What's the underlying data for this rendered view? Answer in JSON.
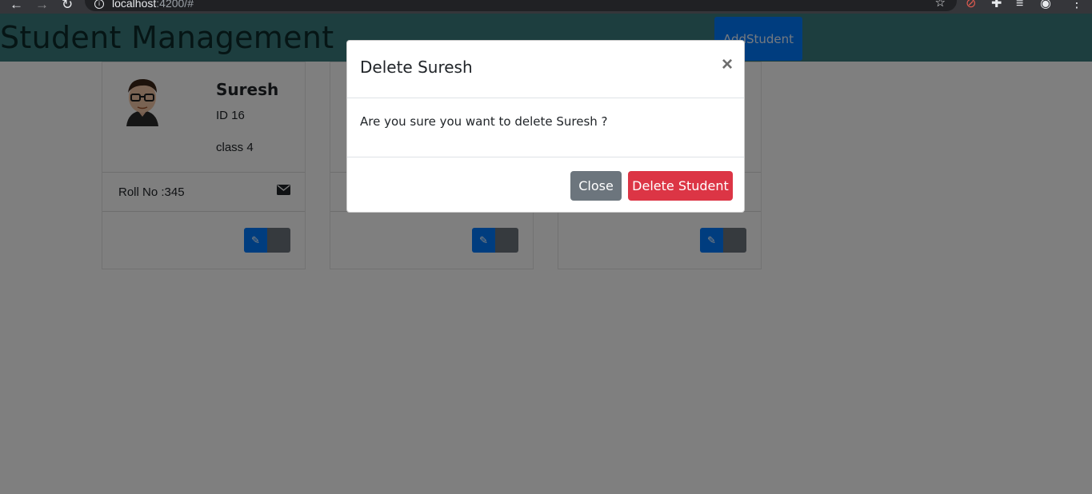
{
  "browser": {
    "url_host": "localhost",
    "url_rest": ":4200/#",
    "back_icon": "back-arrow-icon",
    "forward_icon": "forward-arrow-icon",
    "reload_icon": "reload-icon",
    "star_icon": "star-icon"
  },
  "header": {
    "title": "Student Management",
    "add_button_label": "AddStudent"
  },
  "cards": [
    {
      "name": "Suresh",
      "id_text": "ID 16",
      "class_text": "class 4",
      "roll_text": "Roll No :345"
    }
  ],
  "modal": {
    "title": "Delete Suresh",
    "close_x": "×",
    "message": "Are you sure you want to delete Suresh ?",
    "close_label": "Close",
    "delete_label": "Delete Student"
  },
  "colors": {
    "header_bg": "#3a7c7e",
    "primary": "#007bff",
    "secondary": "#6c757d",
    "danger": "#dc3545"
  }
}
